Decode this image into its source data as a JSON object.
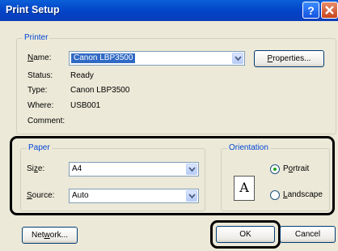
{
  "window": {
    "title": "Print Setup"
  },
  "printer": {
    "legend": "Printer",
    "name_label_pre": "",
    "name_label_u": "N",
    "name_label_post": "ame:",
    "name_value": "Canon LBP3500",
    "properties_u": "P",
    "properties_post": "roperties...",
    "status_label": "Status:",
    "status_value": "Ready",
    "type_label": "Type:",
    "type_value": "Canon LBP3500",
    "where_label": "Where:",
    "where_value": "USB001",
    "comment_label": "Comment:"
  },
  "paper": {
    "legend": "Paper",
    "size_label_pre": "Si",
    "size_label_u": "z",
    "size_label_post": "e:",
    "size_value": "A4",
    "source_label_u": "S",
    "source_label_post": "ource:",
    "source_value": "Auto"
  },
  "orientation": {
    "legend": "Orientation",
    "icon_letter": "A",
    "portrait_pre": "P",
    "portrait_u": "o",
    "portrait_post": "rtrait",
    "landscape_u": "L",
    "landscape_post": "andscape",
    "selected": "portrait"
  },
  "buttons": {
    "network_pre": "Net",
    "network_u": "w",
    "network_post": "ork...",
    "ok": "OK",
    "cancel": "Cancel"
  }
}
